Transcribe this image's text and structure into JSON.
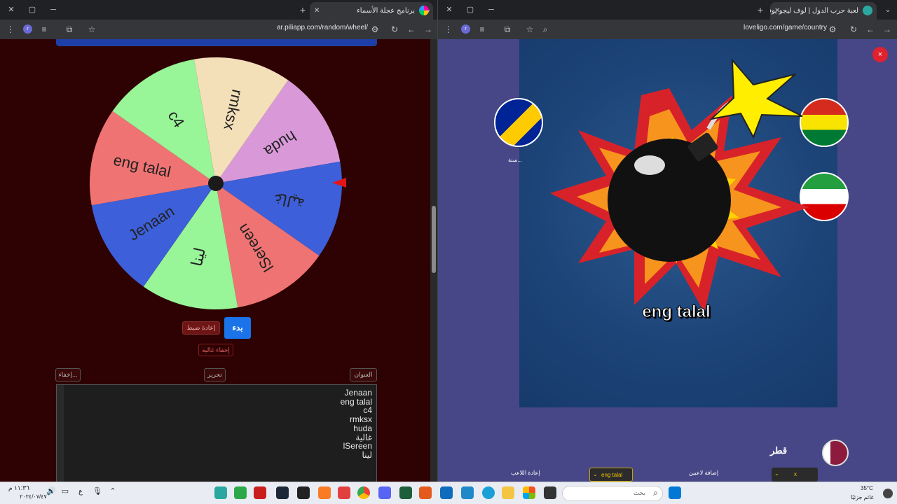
{
  "left_window": {
    "tab_title": "برنامج عجلة الأسماء",
    "url": "ar.piliapp.com/random/wheel/",
    "wheel": {
      "segments": [
        {
          "label": "rmksx",
          "color": "#f3dfb8"
        },
        {
          "label": "huda",
          "color": "#d999d9"
        },
        {
          "label": "غالية",
          "color": "#3d5fd9"
        },
        {
          "label": "lSereen",
          "color": "#f07373"
        },
        {
          "label": "لينا",
          "color": "#98f598"
        },
        {
          "label": "Jenaan",
          "color": "#3d5fd9"
        },
        {
          "label": "eng talal",
          "color": "#f07373"
        },
        {
          "label": "c4",
          "color": "#98f598"
        }
      ]
    },
    "start_button": "بدء",
    "reset_button": "إعادة ضبط",
    "hide_selected_button": "إخفاء غالية",
    "title_button": "العنوان",
    "edit_button": "تحرير",
    "hide_button": "إخفاء...",
    "names": [
      "Jenaan",
      "eng talal",
      "c4",
      "rmksx",
      "huda",
      "غالية",
      "lSereen",
      "لينا"
    ]
  },
  "right_window": {
    "tab_title": "لعبة حرب الدول | لوف ليجو يوفر",
    "url": "loveligo.com/game/country",
    "close_label": "×",
    "selected_name": "eng talal",
    "partial_flag_label": "...سنة",
    "country_name": "قطر",
    "reset_players_button": "إعادة اللاعب",
    "add_players_button": "إضافة لاعبين",
    "player_select_value": "eng talal",
    "x_select_value": "x"
  },
  "taskbar": {
    "time": "١١:٣٦ م",
    "date": "٢٠٢٤/٠٧/٤٧",
    "temperature": "35°C",
    "weather_label": "غائم جزئيًا",
    "search_placeholder": "بحث",
    "language": "ع"
  },
  "colors": {
    "left_bg": "#2e0203",
    "right_bg": "#474787",
    "accent_blue": "#1a73e8",
    "danger_red": "#b52b2b"
  }
}
